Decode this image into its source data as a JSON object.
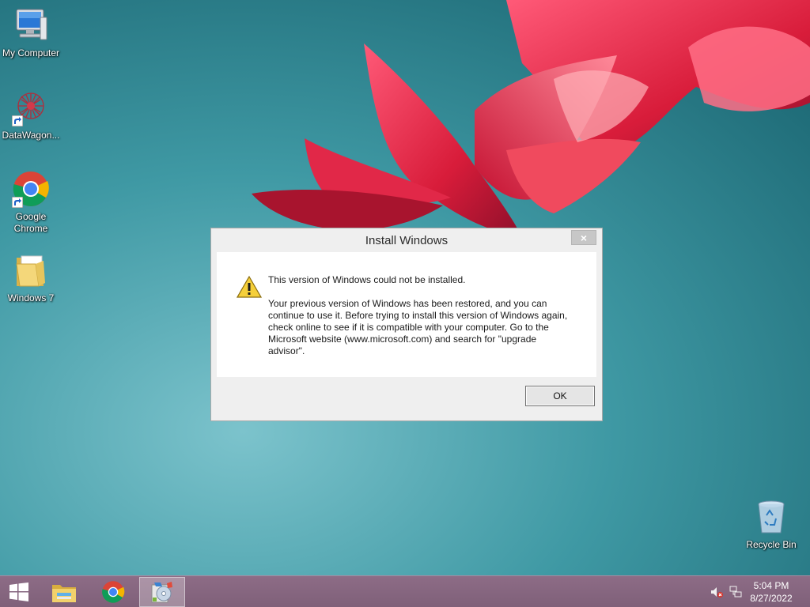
{
  "desktop": {
    "icons": [
      {
        "label": "My Computer",
        "icon": "computer-icon"
      },
      {
        "label": "DataWagon...",
        "icon": "datawagon-icon"
      },
      {
        "label": "Google Chrome",
        "icon": "chrome-icon"
      },
      {
        "label": "Windows 7",
        "icon": "folder-icon"
      },
      {
        "label": "Recycle Bin",
        "icon": "recycle-bin-icon"
      }
    ]
  },
  "dialog": {
    "title": "Install Windows",
    "close_symbol": "×",
    "message_title": "This version of Windows could not be installed.",
    "message_body": "Your previous version of Windows has been restored, and you can continue to use it.  Before trying to install this version of Windows again, check online to see if it is compatible with your computer.  Go to the Microsoft website (www.microsoft.com) and search for \"upgrade advisor\".",
    "ok_label": "OK"
  },
  "taskbar": {
    "items": [
      "start-icon",
      "file-explorer-icon",
      "chrome-icon",
      "windows-setup-icon"
    ],
    "tray": [
      "volume-muted-icon",
      "network-icon"
    ],
    "time": "5:04 PM",
    "date": "8/27/2022"
  },
  "colors": {
    "wallpaper_teal": "#3b8f9a",
    "flower_red": "#d8203a",
    "taskbar": "#8d6c86"
  }
}
